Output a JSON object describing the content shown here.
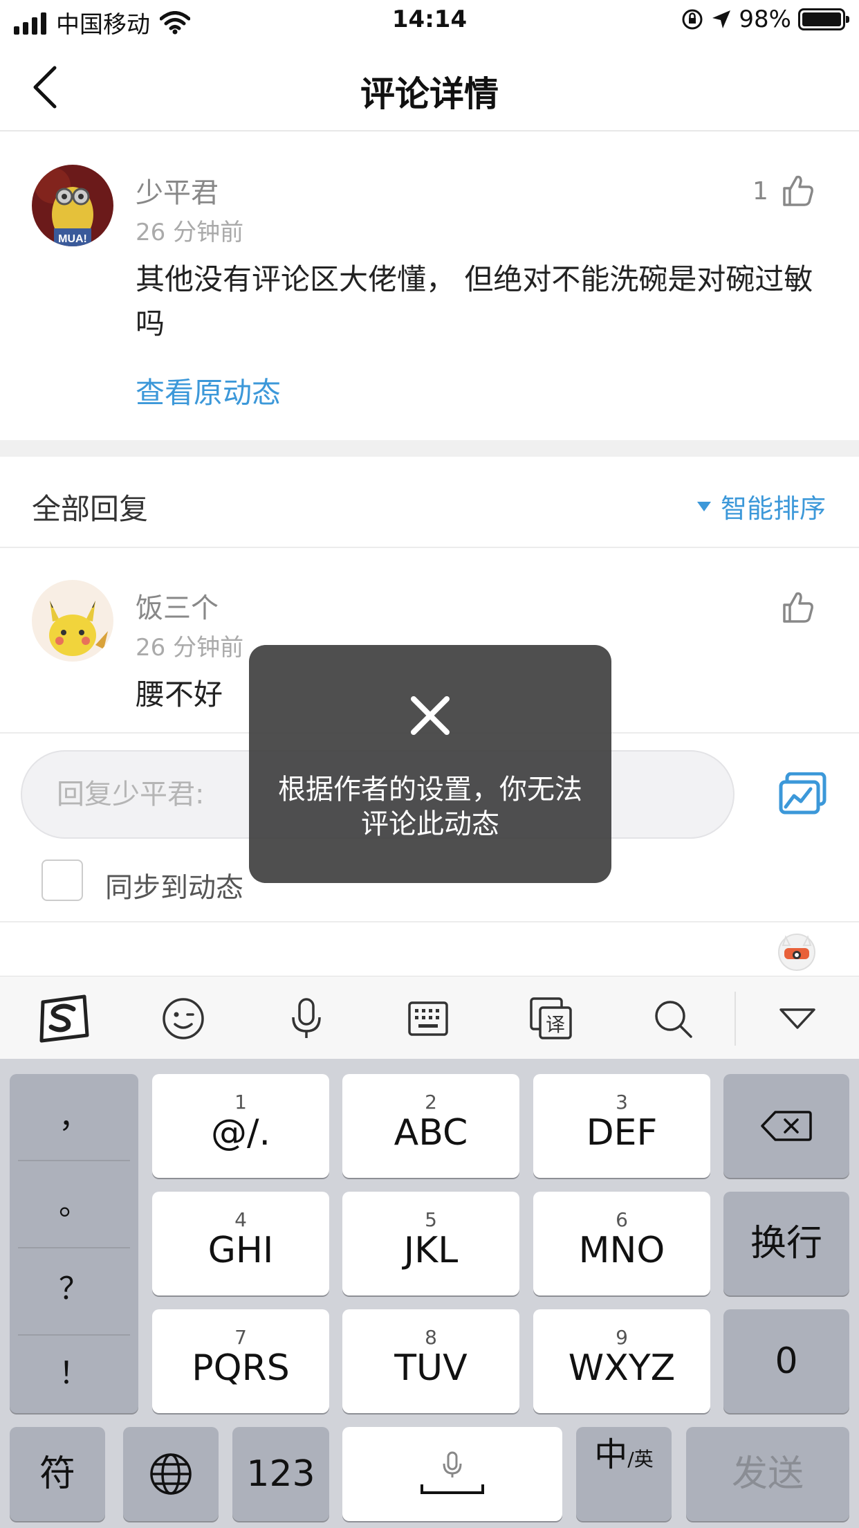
{
  "status_bar": {
    "carrier": "中国移动",
    "time": "14:14",
    "battery": "98%"
  },
  "nav": {
    "title": "评论详情"
  },
  "comment": {
    "username": "少平君",
    "time_ago": "26 分钟前",
    "likes": "1",
    "text": "其他没有评论区大佬懂， 但绝对不能洗碗是对碗过敏吗",
    "view_original": "查看原动态"
  },
  "replies": {
    "title": "全部回复",
    "sort_label": "智能排序",
    "items": [
      {
        "username": "饭三个",
        "time_ago": "26 分钟前",
        "text": "腰不好"
      }
    ]
  },
  "reply_box": {
    "placeholder": "回复少平君:",
    "sync_label": "同步到动态"
  },
  "toast": {
    "message": "根据作者的设置，你无法评论此动态"
  },
  "ime_toolbar": {
    "icons": [
      "sogou-logo-icon",
      "emoji-icon",
      "microphone-icon",
      "keyboard-icon",
      "translate-icon",
      "search-icon",
      "collapse-icon"
    ],
    "translate_glyph": "译"
  },
  "keyboard": {
    "punctuation": [
      "，",
      "。",
      "？",
      "！"
    ],
    "keys": [
      {
        "num": "1",
        "label": "@/."
      },
      {
        "num": "2",
        "label": "ABC"
      },
      {
        "num": "3",
        "label": "DEF"
      },
      {
        "num": "4",
        "label": "GHI"
      },
      {
        "num": "5",
        "label": "JKL"
      },
      {
        "num": "6",
        "label": "MNO"
      },
      {
        "num": "7",
        "label": "PQRS"
      },
      {
        "num": "8",
        "label": "TUV"
      },
      {
        "num": "9",
        "label": "WXYZ"
      }
    ],
    "newline": "换行",
    "zero": "0",
    "symbols": "符",
    "num_mode": "123",
    "lang_main": "中",
    "lang_sub": "/英",
    "send": "发送"
  },
  "colors": {
    "accent": "#3c98d9",
    "toast_bg": "#404040",
    "keyboard_bg": "#d1d3d9"
  }
}
